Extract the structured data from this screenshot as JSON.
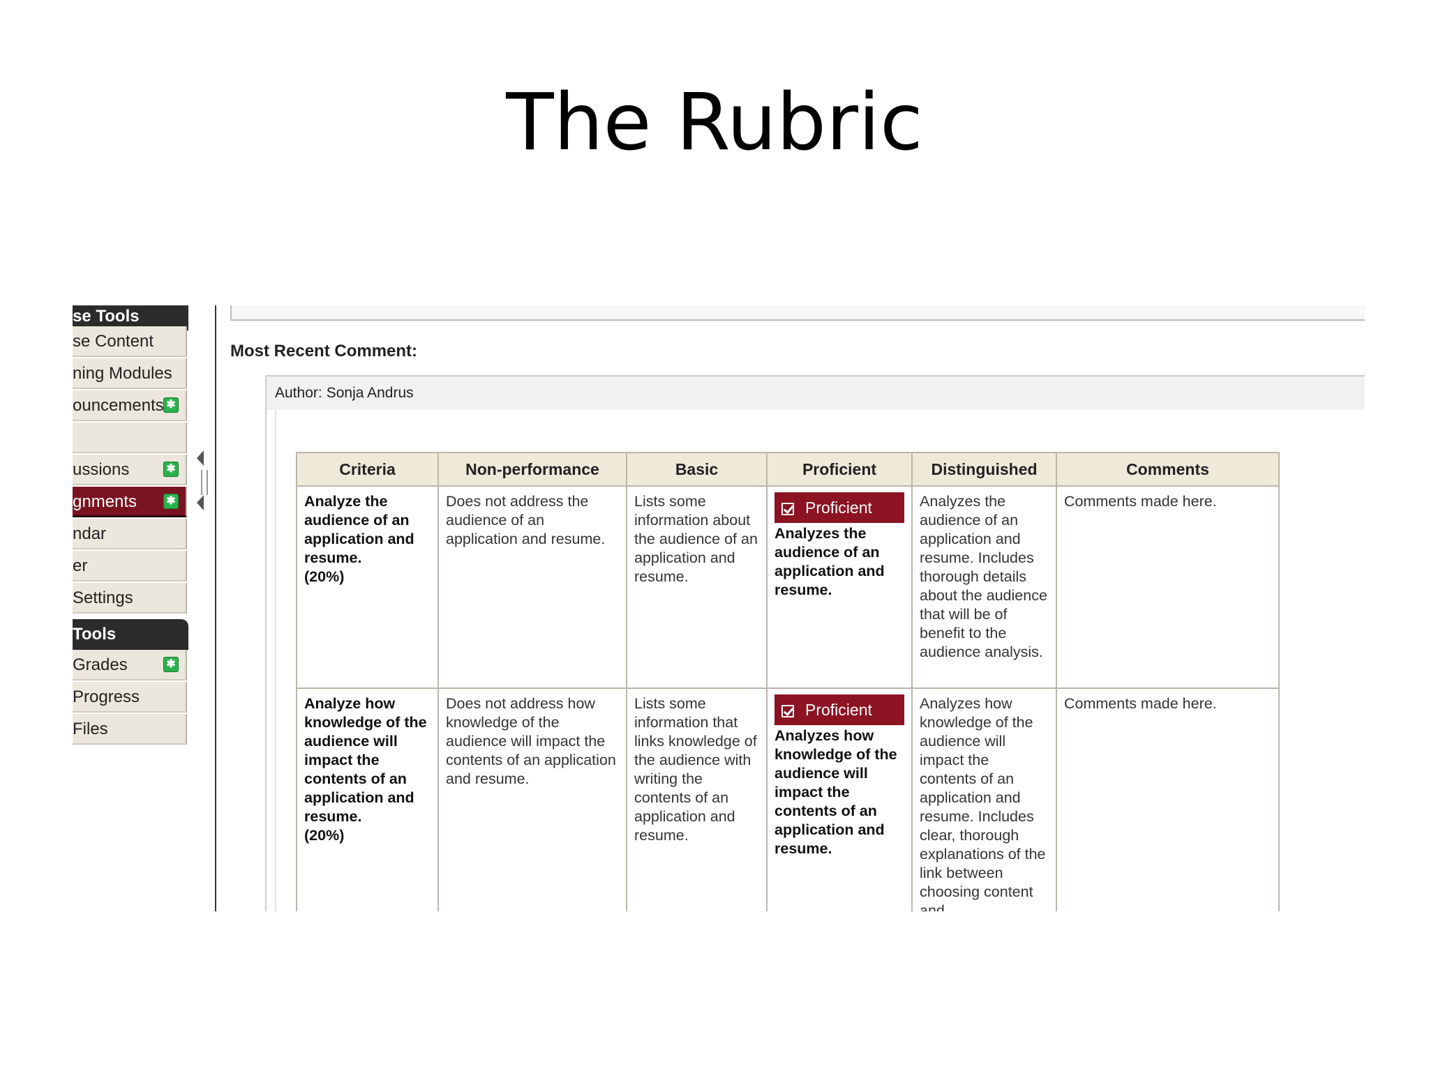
{
  "slide": {
    "title": "The Rubric"
  },
  "sidebar": {
    "group1_header": "se Tools",
    "group1_items": [
      {
        "label": "se Content",
        "new": false,
        "active": false
      },
      {
        "label": "ning Modules",
        "new": false,
        "active": false
      },
      {
        "label": "ouncements",
        "new": true,
        "active": false
      },
      {
        "label": "",
        "new": false,
        "active": false
      },
      {
        "label": "ussions",
        "new": true,
        "active": false
      },
      {
        "label": "gnments",
        "new": true,
        "active": true
      },
      {
        "label": "ndar",
        "new": false,
        "active": false
      },
      {
        "label": "er",
        "new": false,
        "active": false
      },
      {
        "label": "Settings",
        "new": false,
        "active": false
      }
    ],
    "group2_header": "Tools",
    "group2_items": [
      {
        "label": "Grades",
        "new": true,
        "active": false
      },
      {
        "label": "Progress",
        "new": false,
        "active": false
      },
      {
        "label": "Files",
        "new": false,
        "active": false
      }
    ],
    "new_badge_symbol": "✱"
  },
  "comment": {
    "heading": "Most Recent Comment:",
    "author_label": "Author:",
    "author_name": "Sonja Andrus"
  },
  "rubric": {
    "headers": [
      "Criteria",
      "Non-performance",
      "Basic",
      "Proficient",
      "Distinguished",
      "Comments"
    ],
    "badge_label": "Proficient",
    "rows": [
      {
        "criteria": "Analyze the audience of an application and resume.\n(20%)",
        "nonperf": "Does not address the audience of an application and resume.",
        "basic": "Lists some information about the audience of an application and resume.",
        "proficient": "Analyzes the audience of an application and resume.",
        "distinguished": "Analyzes the audience of an application and resume. Includes thorough details about the audience that will be of benefit to the audience analysis.",
        "comments": "Comments made here."
      },
      {
        "criteria": "Analyze how knowledge of the audience will impact the contents of an application and resume.\n(20%)",
        "nonperf": "Does not address how knowledge of the audience will impact the contents of an application and resume.",
        "basic": "Lists some information that links knowledge of the audience with writing the contents of an application and resume.",
        "proficient": "Analyzes how knowledge of the audience will impact the contents of an application and resume.",
        "distinguished": "Analyzes how knowledge of the audience will impact the contents of an application and resume. Includes clear, thorough explanations of the link between choosing content and",
        "comments": "Comments made here."
      }
    ]
  }
}
